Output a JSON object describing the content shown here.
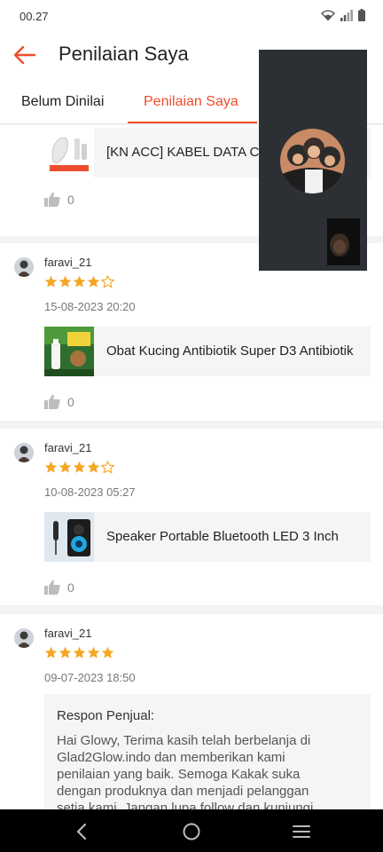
{
  "status_bar": {
    "time": "00.27",
    "icons": [
      "wifi-icon",
      "signal-icon",
      "battery-icon"
    ]
  },
  "header": {
    "title": "Penilaian Saya",
    "back_icon": "arrow-left-icon"
  },
  "tabs": [
    {
      "label": "Belum Dinilai",
      "active": false
    },
    {
      "label": "Penilaian Saya",
      "active": true
    }
  ],
  "colors": {
    "accent": "#ee4d2d",
    "star": "#f5a623",
    "star_empty": "#cfcfcf"
  },
  "reviews": [
    {
      "product_name": "[KN ACC] KABEL DATA C",
      "likes": "0"
    },
    {
      "username": "faravi_21",
      "rating": 4,
      "date": "15-08-2023 20:20",
      "product_name": "Obat Kucing Antibiotik Super D3 Antibiotik",
      "likes": "0"
    },
    {
      "username": "faravi_21",
      "rating": 4,
      "date": "10-08-2023 05:27",
      "product_name": "Speaker Portable Bluetooth LED 3 Inch",
      "likes": "0"
    },
    {
      "username": "faravi_21",
      "rating": 5,
      "date": "09-07-2023 18:50",
      "response": {
        "title": "Respon Penjual:",
        "text": "Hai Glowy, Terima kasih telah berbelanja di Glad2Glow.indo dan memberikan kami penilaian yang baik. Semoga Kakak suka dengan produknya dan menjadi pelanggan setia kami. Jangan lupa follow dan kunjungi"
      }
    }
  ],
  "nav_bar": {
    "icons": [
      "back-chevron-icon",
      "home-circle-icon",
      "menu-lines-icon"
    ]
  }
}
